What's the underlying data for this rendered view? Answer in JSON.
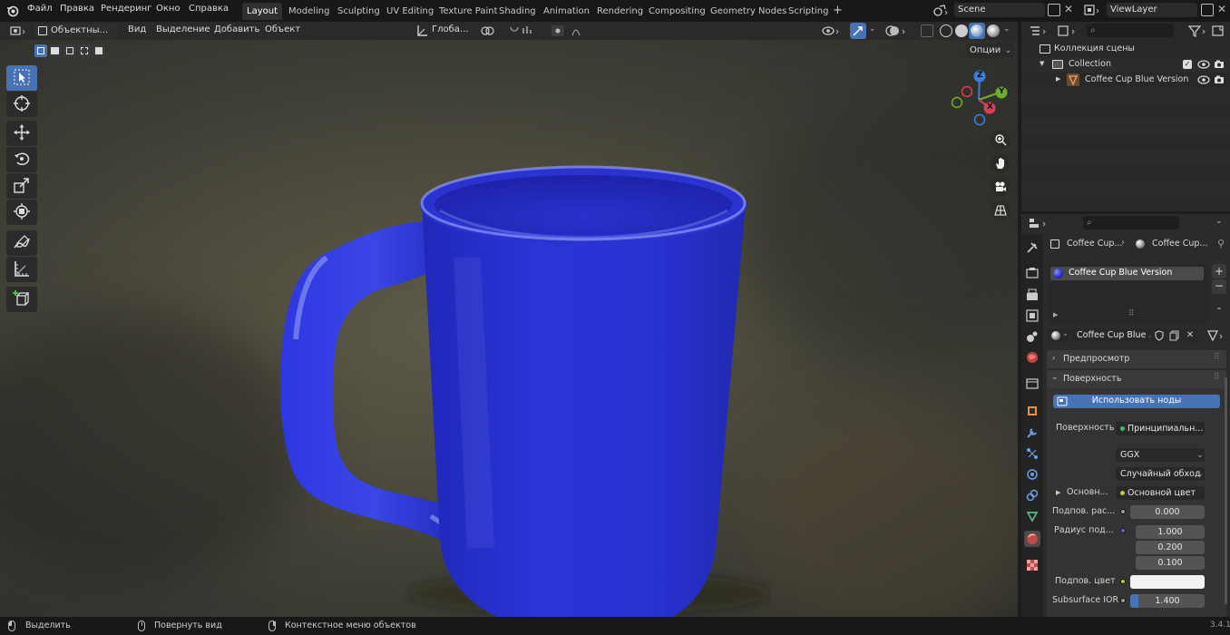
{
  "topbar": {
    "menus": [
      "Файл",
      "Правка",
      "Рендеринг",
      "Окно",
      "Справка"
    ],
    "workspaces": [
      "Layout",
      "Modeling",
      "Sculpting",
      "UV Editing",
      "Texture Paint",
      "Shading",
      "Animation",
      "Rendering",
      "Compositing",
      "Geometry Nodes",
      "Scripting"
    ],
    "active_workspace": "Layout",
    "scene": "Scene",
    "view_layer": "ViewLayer"
  },
  "viewport_header": {
    "mode": "Объектны...",
    "menus": [
      "Вид",
      "Выделение",
      "Добавить",
      "Объект"
    ],
    "transform_orientation": "Глоба...",
    "options": "Опции"
  },
  "viewport": {
    "object_color": "#2a2fd2",
    "gizmo": {
      "z": "Z",
      "y": "Y",
      "x": "X"
    }
  },
  "outliner": {
    "scene_collection": "Коллекция сцены",
    "collection": "Collection",
    "object": "Coffee Cup Blue Version"
  },
  "properties": {
    "breadcrumb": [
      "Coffee Cup...",
      "Coffee Cup..."
    ],
    "material_slot": "Coffee Cup Blue Version",
    "material_name": "Coffee Cup Blue ...",
    "panels": {
      "preview": "Предпросмотр",
      "surface": "Поверхность"
    },
    "use_nodes_button": "Использовать ноды",
    "surface_label": "Поверхность",
    "surface_shader": "Принципиальн...",
    "distribution": "GGX",
    "subsurface_method": "Случайный обход",
    "base_label": "Основн...",
    "base_value": "Основной цвет",
    "subsurface_label": "Подпов. рас...",
    "subsurface_value": "0.000",
    "radius_label": "Радиус под...",
    "radius_values": [
      "1.000",
      "0.200",
      "0.100"
    ],
    "subsurface_color_label": "Подпов. цвет",
    "subsurface_ior_label": "Subsurface IOR",
    "subsurface_ior_value": "1.400"
  },
  "statusbar": {
    "select": "Выделить",
    "rotate": "Повернуть вид",
    "context": "Контекстное меню объектов",
    "version": "3.4.1"
  }
}
